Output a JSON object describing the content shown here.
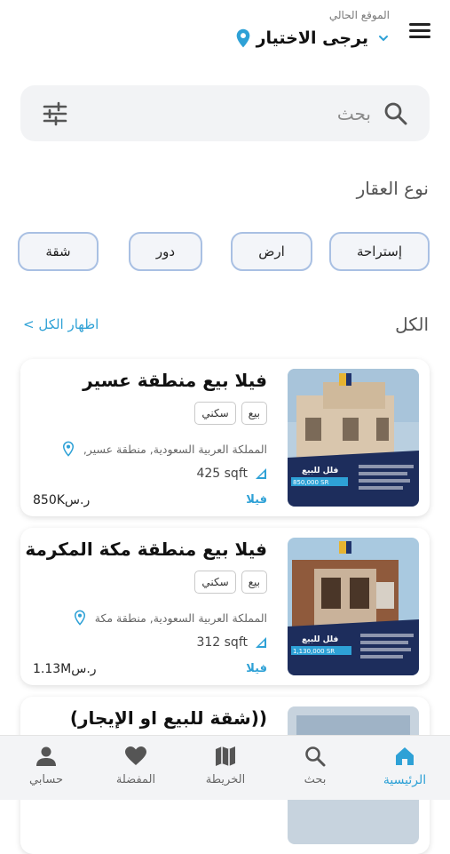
{
  "header": {
    "location_caption": "الموقع الحالي",
    "location_value": "يرجى الاختيار",
    "menu_icon": "hamburger-icon",
    "accent": "#2ea1d6"
  },
  "search": {
    "placeholder": "بحث",
    "search_icon": "search-icon",
    "filter_icon": "filter-sliders-icon"
  },
  "property_types": {
    "title": "نوع العقار",
    "chips": [
      "إستراحة",
      "ارض",
      "دور",
      "شقة"
    ]
  },
  "listings": {
    "title": "الكل",
    "show_all": "اظهار الكل >",
    "items": [
      {
        "title": "فيلا بيع منطقة عسير",
        "tags": [
          "بيع",
          "سكني"
        ],
        "address": "المملكة العربية السعودية, منطقة عسير,",
        "area": "425 sqft",
        "type": "فيلا",
        "price": "850Kر.س",
        "image_banner": "فلل للبيع",
        "image_price": "850,000 SR"
      },
      {
        "title": "فيلا بيع منطقة مكة المكرمة",
        "tags": [
          "بيع",
          "سكني"
        ],
        "address": "المملكة العربية السعودية, منطقة مكة",
        "area": "312 sqft",
        "type": "فيلا",
        "price": "1.13Mر.س",
        "image_banner": "فلل للبيع",
        "image_price": "1,130,000 SR"
      },
      {
        "title": "((شقة للبيع او الإيجار)"
      }
    ]
  },
  "bottom_nav": {
    "items": [
      {
        "label": "الرئيسية",
        "icon": "home-icon",
        "active": true
      },
      {
        "label": "بحث",
        "icon": "search-icon",
        "active": false
      },
      {
        "label": "الخريطة",
        "icon": "map-icon",
        "active": false
      },
      {
        "label": "المفضلة",
        "icon": "heart-icon",
        "active": false
      },
      {
        "label": "حسابي",
        "icon": "person-icon",
        "active": false
      }
    ]
  }
}
